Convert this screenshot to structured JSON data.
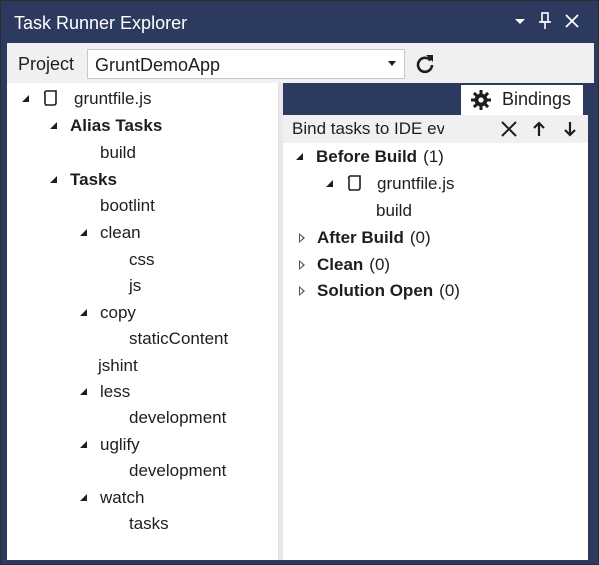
{
  "window": {
    "title": "Task Runner Explorer",
    "colors": {
      "chrome": "#2b3a5e",
      "panel": "#ffffff",
      "toolbar": "#f0f0f0"
    }
  },
  "titlebar": {
    "dropdown_icon": "dropdown-arrow-icon",
    "pin_icon": "pin-icon",
    "close_icon": "close-icon"
  },
  "project": {
    "label": "Project",
    "selected": "GruntDemoApp",
    "refresh_icon": "refresh-icon"
  },
  "tree": {
    "root": {
      "label": "gruntfile.js",
      "icon": "grunt-file-icon"
    },
    "alias_group": {
      "label": "Alias Tasks",
      "items": [
        "build"
      ]
    },
    "tasks_group": {
      "label": "Tasks",
      "bootlint": "bootlint",
      "clean": {
        "label": "clean",
        "children": [
          "css",
          "js"
        ]
      },
      "copy": {
        "label": "copy",
        "children": [
          "staticContent"
        ]
      },
      "jshint": "jshint",
      "less": {
        "label": "less",
        "children": [
          "development"
        ]
      },
      "uglify": {
        "label": "uglify",
        "children": [
          "development"
        ]
      },
      "watch": {
        "label": "watch",
        "children": [
          "tasks"
        ]
      }
    }
  },
  "bindings": {
    "tab_label": "Bindings",
    "tab_icon": "gear-icon",
    "toolbar_text": "Bind tasks to IDE events",
    "toolbar_icons": [
      "remove-icon",
      "move-up-icon",
      "move-down-icon"
    ],
    "before_build": {
      "label": "Before Build",
      "count": "(1)",
      "file": "gruntfile.js",
      "task": "build"
    },
    "after_build": {
      "label": "After Build",
      "count": "(0)"
    },
    "clean": {
      "label": "Clean",
      "count": "(0)"
    },
    "solution_open": {
      "label": "Solution Open",
      "count": "(0)"
    }
  }
}
